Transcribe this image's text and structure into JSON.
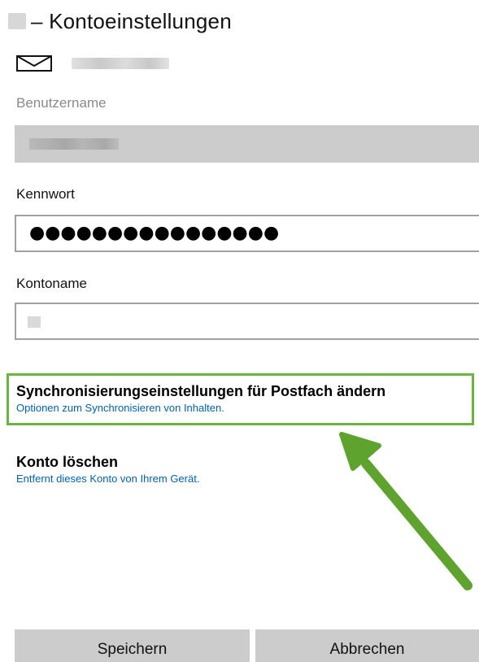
{
  "header": {
    "title": "– Kontoeinstellungen"
  },
  "account": {
    "icon": "mail-icon"
  },
  "fields": {
    "username_label": "Benutzername",
    "password_label": "Kennwort",
    "password_value": "●●●●●●●●●●●●●●●●",
    "accountname_label": "Kontoname"
  },
  "sync": {
    "heading": "Synchronisierungseinstellungen für Postfach ändern",
    "subtitle": "Optionen zum Synchronisieren von Inhalten."
  },
  "delete": {
    "heading": "Konto löschen",
    "subtitle": "Entfernt dieses Konto von Ihrem Gerät."
  },
  "buttons": {
    "save": "Speichern",
    "cancel": "Abbrechen"
  },
  "colors": {
    "highlight_border": "#6db33f",
    "arrow": "#5ea32e",
    "link_blue": "#0063b1",
    "button_bg": "#cccccc",
    "disabled_field_bg": "#cccccc"
  }
}
